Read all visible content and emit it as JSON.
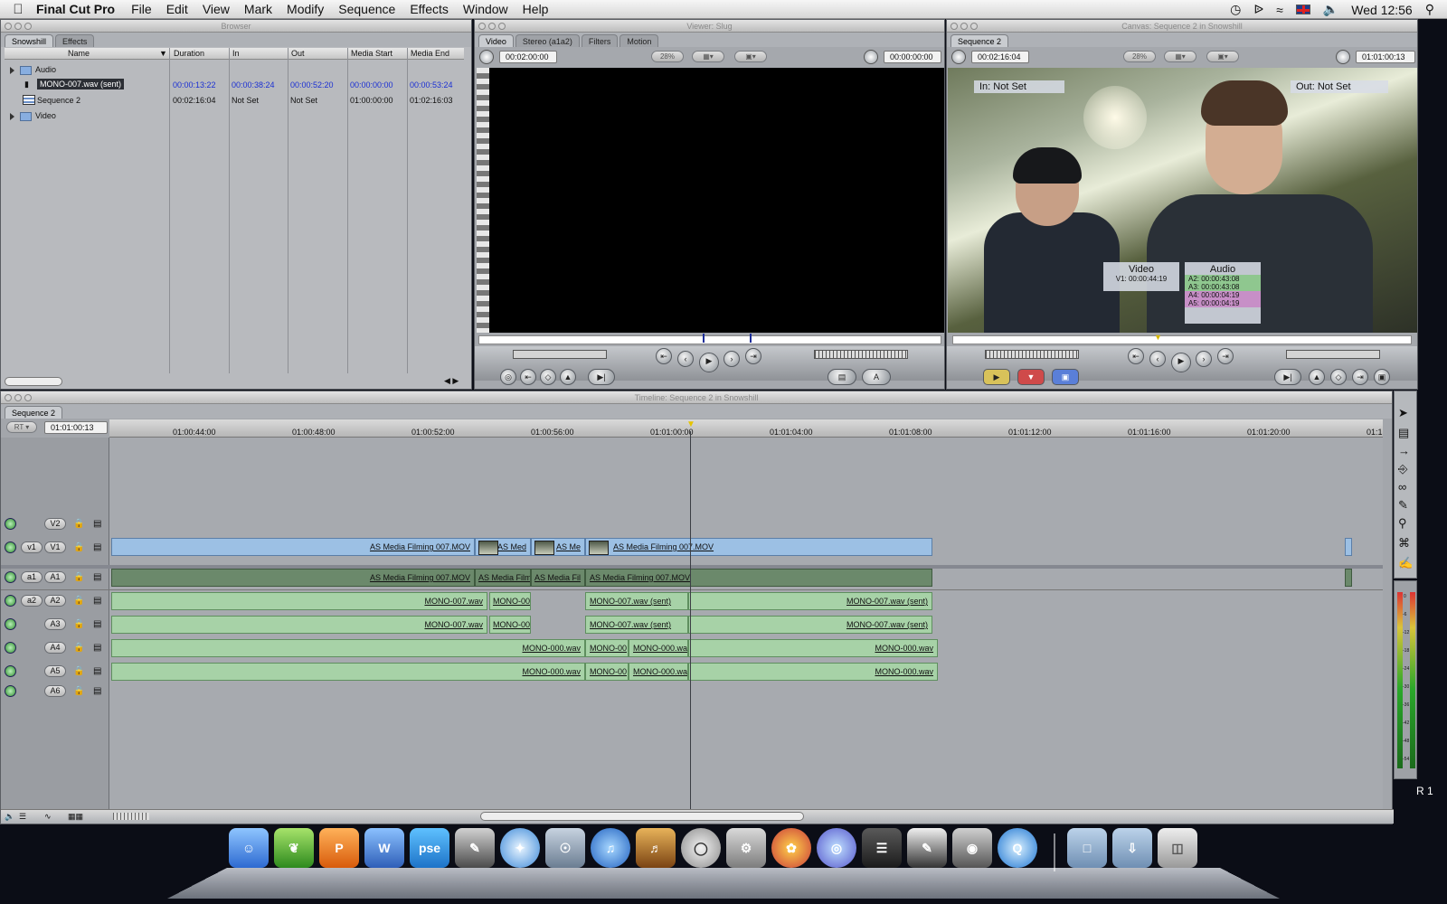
{
  "menubar": {
    "app": "Final Cut Pro",
    "items": [
      "File",
      "Edit",
      "View",
      "Mark",
      "Modify",
      "Sequence",
      "Effects",
      "Window",
      "Help"
    ],
    "clock": "Wed 12:56"
  },
  "browser": {
    "title": "Browser",
    "tabs": [
      "Snowshill",
      "Effects"
    ],
    "columns": [
      "Name",
      "Duration",
      "In",
      "Out",
      "Media Start",
      "Media End"
    ],
    "rows": [
      {
        "name": "Audio",
        "type": "bin"
      },
      {
        "name": "MONO-007.wav (sent)",
        "type": "audio",
        "duration": "00:00:13:22",
        "in": "00:00:38:24",
        "out": "00:00:52:20",
        "media_start": "00:00:00:00",
        "media_end": "00:00:53:24"
      },
      {
        "name": "Sequence 2",
        "type": "sequence",
        "duration": "00:02:16:04",
        "in": "Not Set",
        "out": "Not Set",
        "media_start": "01:00:00:00",
        "media_end": "01:02:16:03"
      },
      {
        "name": "Video",
        "type": "bin"
      }
    ]
  },
  "viewer": {
    "title": "Viewer: Slug",
    "tabs": [
      "Video",
      "Stereo (a1a2)",
      "Filters",
      "Motion"
    ],
    "duration": "00:02:00:00",
    "zoom": "28%",
    "timecode": "00:00:00:00"
  },
  "canvas": {
    "title": "Canvas: Sequence 2 in Snowshill",
    "tab": "Sequence 2",
    "duration": "00:02:16:04",
    "zoom": "28%",
    "timecode": "01:01:00:13",
    "in_label": "In: Not Set",
    "out_label": "Out: Not Set",
    "video_title": "Video",
    "video_line": "V1: 00:00:44:19",
    "audio_title": "Audio",
    "audio_lines": [
      "A2: 00:00:43:08",
      "A3: 00:00:43:08",
      "A4: 00:00:04:19",
      "A5: 00:00:04:19"
    ]
  },
  "timeline": {
    "title": "Timeline: Sequence 2 in Snowshill",
    "tab": "Sequence 2",
    "rt": "RT",
    "timecode": "01:01:00:13",
    "ruler": [
      "01:00:44:00",
      "01:00:48:00",
      "01:00:52:00",
      "01:00:56:00",
      "01:01:00:00",
      "01:01:04:00",
      "01:01:08:00",
      "01:01:12:00",
      "01:01:16:00",
      "01:01:20:00",
      "01:1"
    ],
    "tracks": [
      "V2",
      "V1",
      "A1",
      "A2",
      "A3",
      "A4",
      "A5",
      "A6"
    ],
    "src": [
      "v1",
      "a1",
      "a2"
    ],
    "clips": {
      "v1a": "AS Media Filming 007.MOV",
      "v1b": "AS Med",
      "v1c": "AS Me",
      "v1d": "AS Media Filming 007.MOV",
      "a1a": "AS Media Filming 007.MOV",
      "a1b": "AS Media Film",
      "a1c": "AS Media Fil",
      "a1d": "AS Media Filming 007.MOV",
      "a2a": "MONO-007.wav",
      "a2b": "MONO-00",
      "a2c": "MONO-007.wav (sent)",
      "a2d": "MONO-007.wav (sent)",
      "a4a": "MONO-000.wav",
      "a4b": "MONO-00",
      "a4c": "MONO-000.wa",
      "a4d": "MONO-000.wav"
    }
  },
  "meters": {
    "label": "R 1",
    "scale": [
      "0",
      "-6",
      "-12",
      "-18",
      "-24",
      "-30",
      "-36",
      "-42",
      "-48",
      "-54"
    ]
  },
  "dock": {
    "pse": "pse"
  }
}
